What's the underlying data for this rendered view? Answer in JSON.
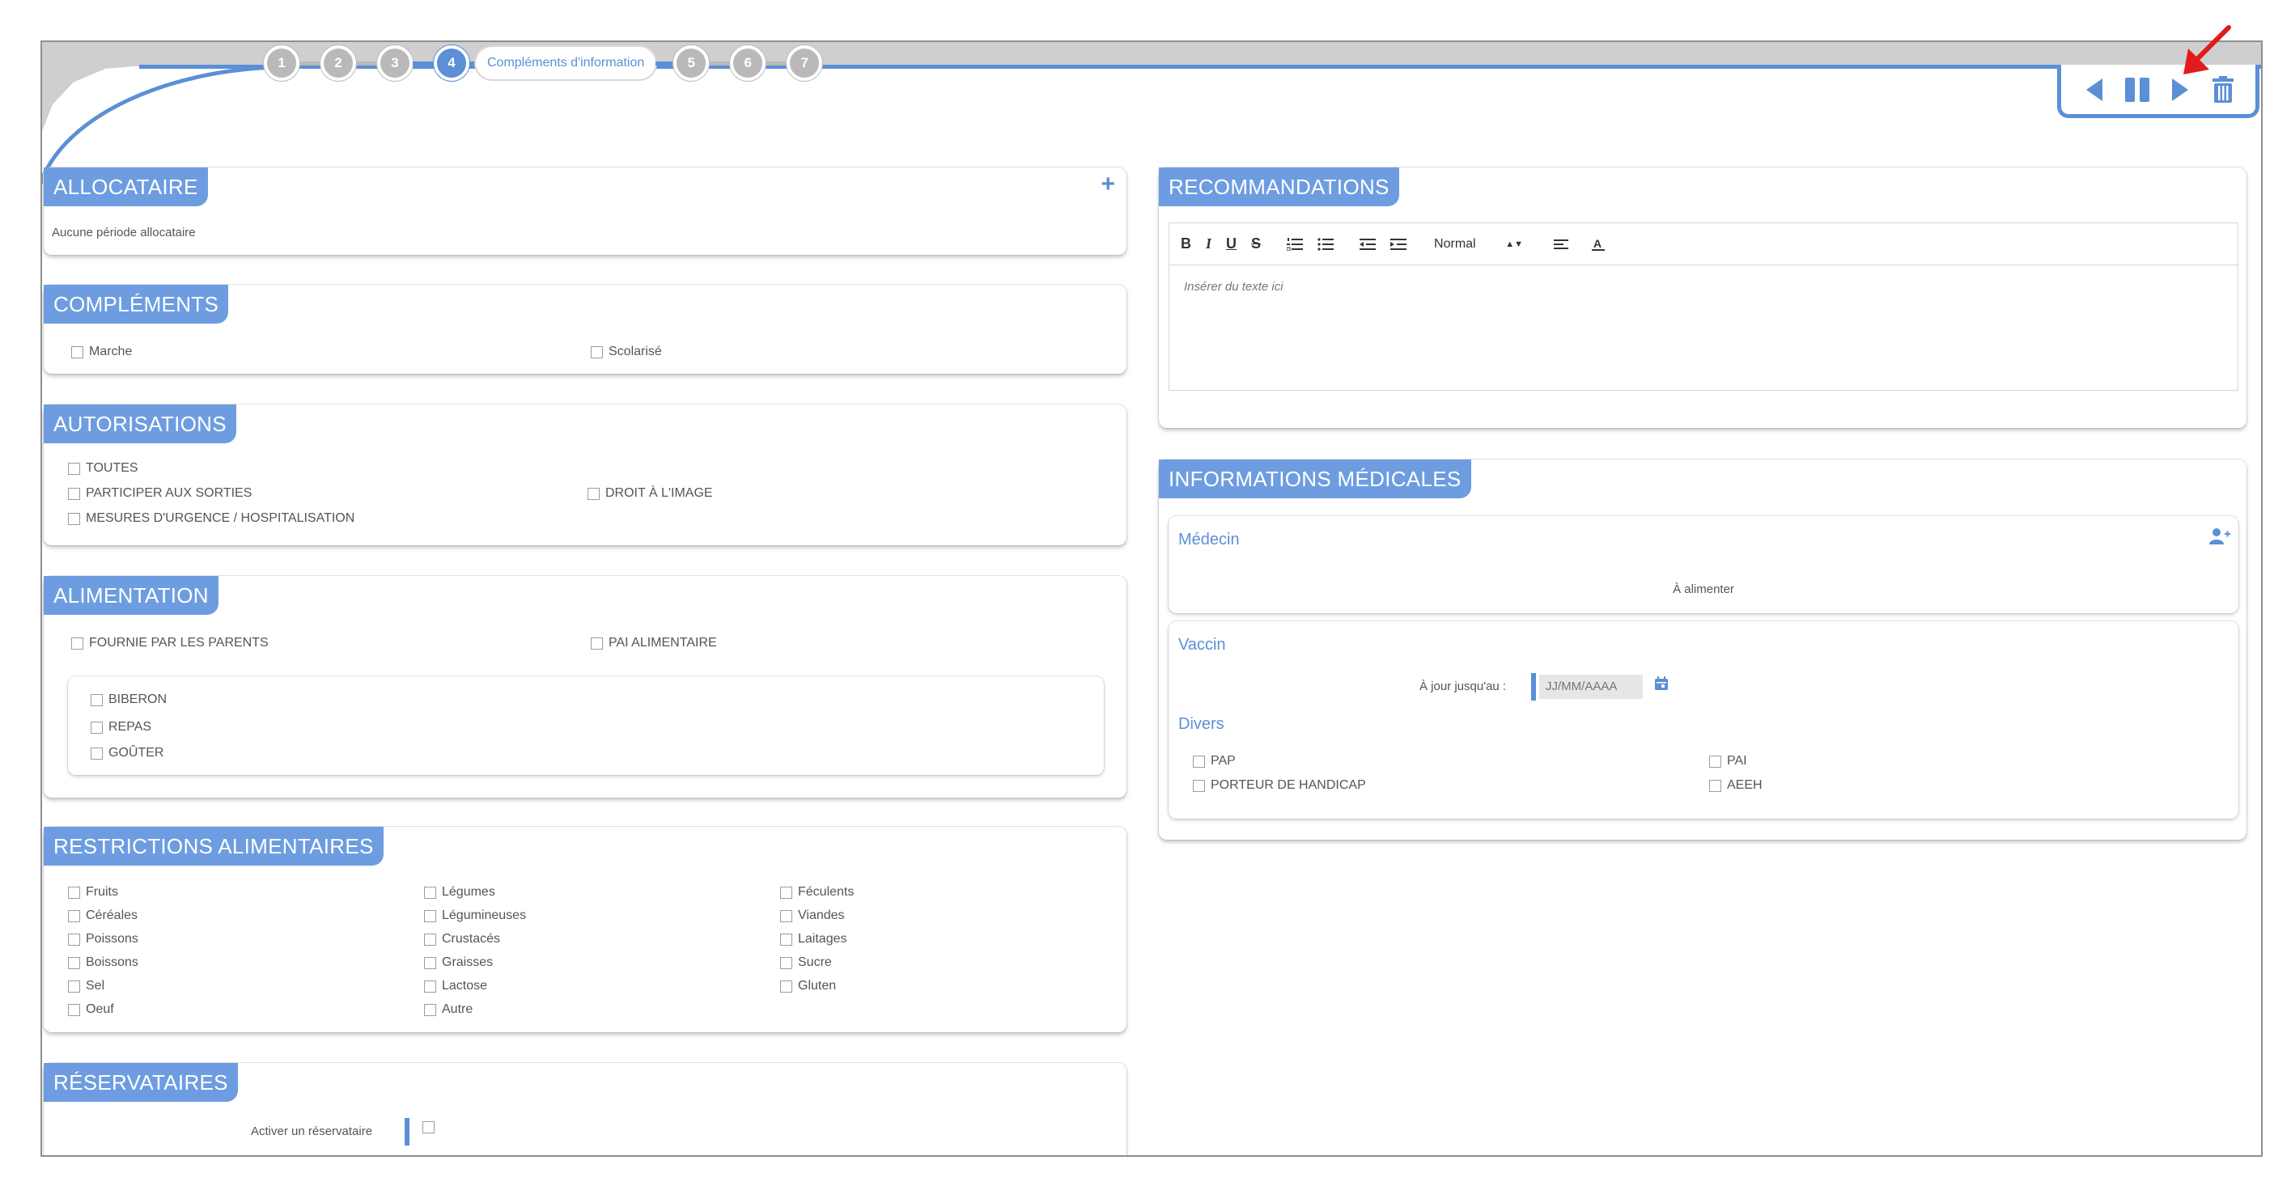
{
  "stepper": {
    "steps": [
      "1",
      "2",
      "3",
      "4",
      "5",
      "6",
      "7"
    ],
    "active_label": "Compléments d'information"
  },
  "allocataire": {
    "title": "ALLOCATAIRE",
    "empty_text": "Aucune période allocataire",
    "add_symbol": "+"
  },
  "complements": {
    "title": "COMPLÉMENTS",
    "items": [
      "Marche",
      "Scolarisé"
    ]
  },
  "autorisations": {
    "title": "AUTORISATIONS",
    "items": [
      "TOUTES",
      "PARTICIPER AUX SORTIES",
      "DROIT À L'IMAGE",
      "MESURES D'URGENCE / HOSPITALISATION"
    ]
  },
  "alimentation": {
    "title": "ALIMENTATION",
    "items": [
      "FOURNIE PAR LES PARENTS",
      "PAI ALIMENTAIRE"
    ],
    "sub_items": [
      "BIBERON",
      "REPAS",
      "GOÛTER"
    ]
  },
  "restrictions": {
    "title": "RESTRICTIONS ALIMENTAIRES",
    "col1": [
      "Fruits",
      "Céréales",
      "Poissons",
      "Boissons",
      "Sel",
      "Oeuf"
    ],
    "col2": [
      "Légumes",
      "Légumineuses",
      "Crustacés",
      "Graisses",
      "Lactose",
      "Autre"
    ],
    "col3": [
      "Féculents",
      "Viandes",
      "Laitages",
      "Sucre",
      "Gluten"
    ]
  },
  "reservataires": {
    "title": "RÉSERVATAIRES",
    "label": "Activer un réservataire"
  },
  "recommandations": {
    "title": "RECOMMANDATIONS",
    "toolbar": {
      "bold": "B",
      "italic": "I",
      "underline": "U",
      "strike": "S",
      "header_select": "Normal"
    },
    "placeholder": "Insérer du texte ici"
  },
  "medical": {
    "title": "INFORMATIONS MÉDICALES",
    "medecin_label": "Médecin",
    "medecin_empty": "À alimenter",
    "vaccin_label": "Vaccin",
    "vaccin_date_label": "À jour jusqu'au :",
    "vaccin_date_placeholder": "JJ/MM/AAAA",
    "divers_label": "Divers",
    "divers_left": [
      "PAP",
      "PORTEUR DE HANDICAP"
    ],
    "divers_right": [
      "PAI",
      "AEEH"
    ]
  },
  "colors": {
    "accent": "#5b8fd6",
    "title_bg": "#6d9de0",
    "annotation_arrow": "#e01b1b"
  }
}
